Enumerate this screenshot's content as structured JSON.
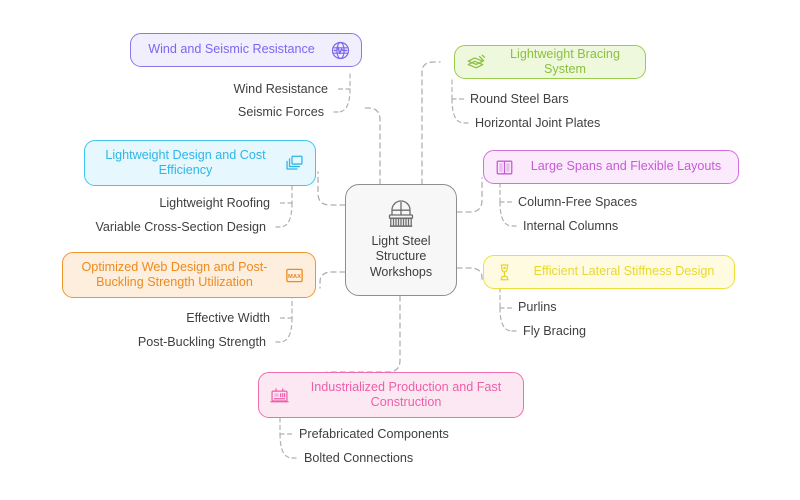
{
  "diagram": {
    "type": "mind-map",
    "background_color": "#ffffff",
    "connector_color": "#b0b0b0",
    "connector_style": "dashed",
    "center": {
      "label": "Light Steel\nStructure\nWorkshops",
      "icon": "balcony-window-icon",
      "fill": "#f7f7f7",
      "border": "#8e8e8e",
      "text_color": "#3d3d3d"
    },
    "branches": [
      {
        "id": "wind-and-seismic-resistance",
        "label": "Wind and Seismic Resistance",
        "icon": "globe-seismic-icon",
        "icon_side": "right",
        "fill": "#f1eefe",
        "border": "#8b78e8",
        "text_color": "#7b68ee",
        "children": [
          "Wind Resistance",
          "Seismic Forces"
        ]
      },
      {
        "id": "lightweight-bracing-system",
        "label": "Lightweight Bracing System",
        "icon": "stacked-plates-icon",
        "icon_side": "left",
        "fill": "#eef8dd",
        "border": "#9ccc4e",
        "text_color": "#8cc03c",
        "children": [
          "Round Steel Bars",
          "Horizontal Joint Plates"
        ]
      },
      {
        "id": "lightweight-design-and-cost-efficiency",
        "label": "Lightweight Design and Cost\nEfficiency",
        "icon": "layered-windows-icon",
        "icon_side": "right",
        "fill": "#e6f7fd",
        "border": "#3ec6f0",
        "text_color": "#2eb6e8",
        "children": [
          "Lightweight Roofing",
          "Variable Cross-Section Design"
        ]
      },
      {
        "id": "large-spans-and-flexible-layouts",
        "label": "Large Spans and Flexible Layouts",
        "icon": "two-columns-icon",
        "icon_side": "left",
        "fill": "#fbeafc",
        "border": "#d36fe0",
        "text_color": "#c65ad6",
        "children": [
          "Column-Free Spaces",
          "Internal Columns"
        ]
      },
      {
        "id": "optimized-web-design-and-post-buckling-strength-utilization",
        "label": "Optimized Web Design and Post-\nBuckling Strength Utilization",
        "icon": "max-badge-icon",
        "icon_side": "right",
        "fill": "#fdeedd",
        "border": "#f0962f",
        "text_color": "#ed8b21",
        "children": [
          "Effective Width",
          "Post-Buckling Strength"
        ]
      },
      {
        "id": "efficient-lateral-stiffness-design",
        "label": "Efficient Lateral Stiffness Design",
        "icon": "lamp-trophy-icon",
        "icon_side": "left",
        "fill": "#fefbe0",
        "border": "#ede03a",
        "text_color": "#e8d92e",
        "children": [
          "Purlins",
          "Fly Bracing"
        ]
      },
      {
        "id": "industrialized-production-and-fast-construction",
        "label": "Industrialized Production and Fast\nConstruction",
        "icon": "factory-machine-icon",
        "icon_side": "left",
        "fill": "#fce8f3",
        "border": "#ef6db0",
        "text_color": "#ee5fa8",
        "children": [
          "Prefabricated Components",
          "Bolted Connections"
        ]
      }
    ]
  }
}
